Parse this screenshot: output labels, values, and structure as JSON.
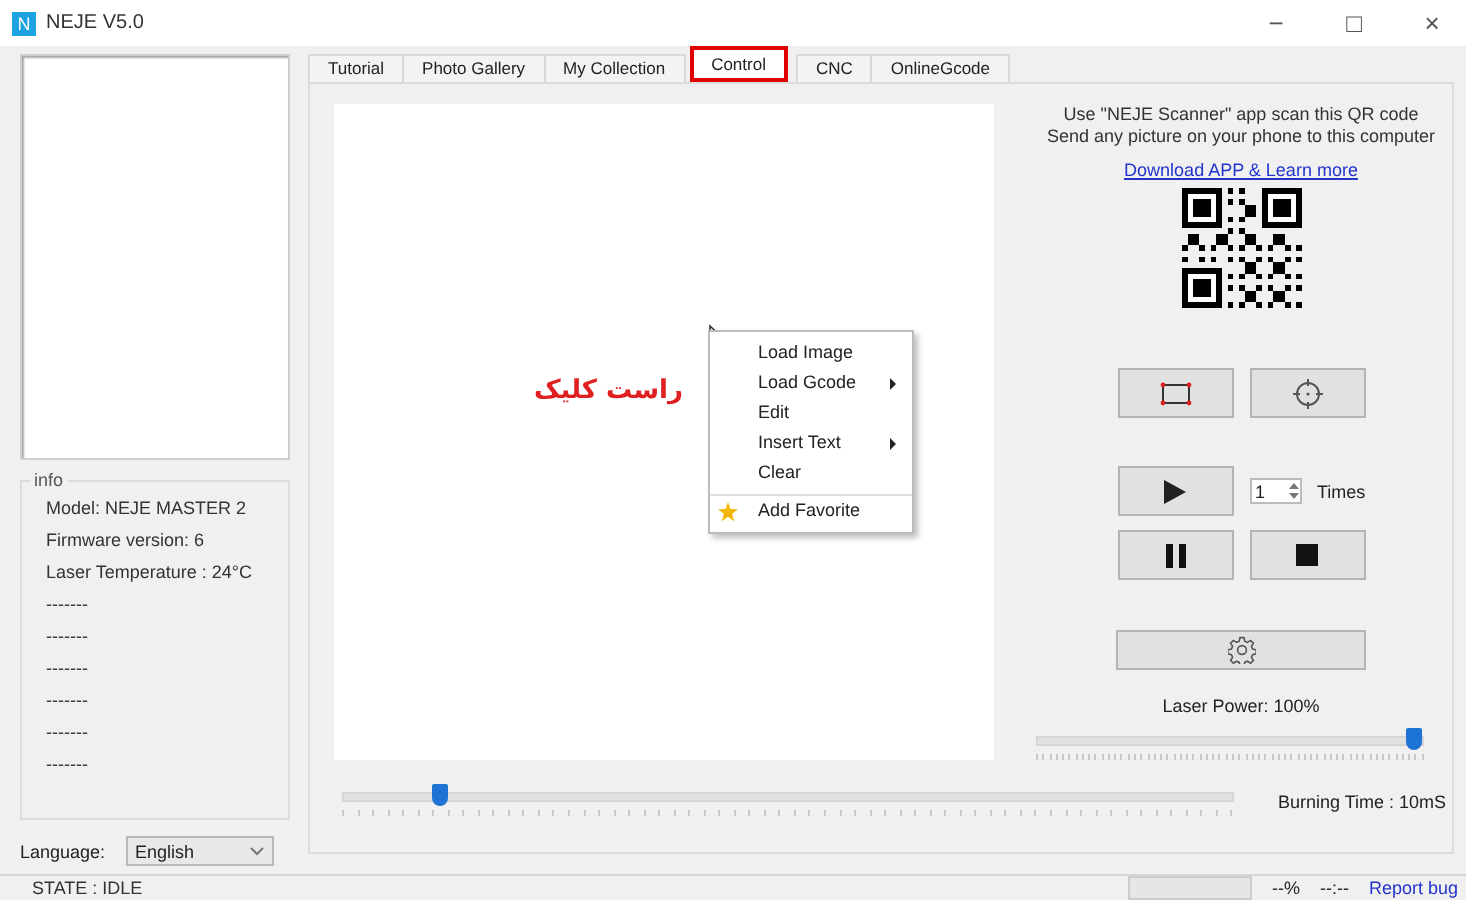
{
  "window": {
    "logo": "N",
    "title": "NEJE V5.0",
    "controls": [
      "−",
      "□",
      "×"
    ]
  },
  "info": {
    "title": "info",
    "lines": [
      "Model: NEJE MASTER 2",
      "Firmware version: 6",
      "Laser Temperature : 24°C",
      "-------",
      "-------",
      "-------",
      "-------",
      "-------",
      "-------"
    ]
  },
  "language": {
    "label": "Language:",
    "value": "English"
  },
  "tabs": [
    {
      "label": "Tutorial",
      "selected": false
    },
    {
      "label": "Photo Gallery",
      "selected": false
    },
    {
      "label": "My Collection",
      "selected": false
    },
    {
      "label": "Control",
      "selected": true
    },
    {
      "label": "CNC",
      "selected": false
    },
    {
      "label": "OnlineGcode",
      "selected": false
    }
  ],
  "canvas": {
    "annotation": "راست کلیک"
  },
  "context_menu": {
    "items": [
      {
        "label": "Load Image",
        "kind": "action",
        "submenu": false
      },
      {
        "label": "Load Gcode",
        "kind": "action",
        "submenu": true
      },
      {
        "label": "Edit",
        "kind": "action",
        "submenu": false
      },
      {
        "label": "Insert Text",
        "kind": "action",
        "submenu": true
      },
      {
        "label": "Clear",
        "kind": "action",
        "submenu": false
      },
      {
        "label": "Add Favorite",
        "kind": "favorite",
        "submenu": false
      }
    ]
  },
  "scanner": {
    "lines": [
      "Use \"NEJE Scanner\" app scan this QR code",
      "Send any picture on your phone to this computer"
    ],
    "link": "Download APP & Learn more"
  },
  "repeat": {
    "value": "1",
    "label": "Times"
  },
  "laser_power": {
    "label": "Laser Power: 100%",
    "level": 1
  },
  "burning_time": {
    "label": "Burning Time : 10mS",
    "level": 0.1
  },
  "status_bar": {
    "state": "STATE : IDLE",
    "progress": {
      "level": 0
    },
    "percent": "--%",
    "time": "--:--",
    "link": "Report bug"
  }
}
